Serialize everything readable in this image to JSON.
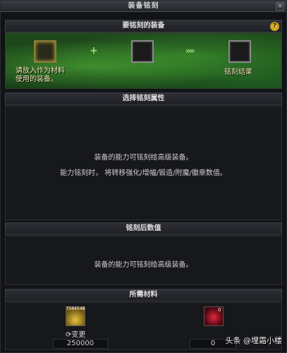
{
  "window": {
    "title": "装备铭刻",
    "close_label": "×"
  },
  "top_section": {
    "title": "要铭刻的装备",
    "help_label": "?"
  },
  "slots": {
    "material_caption": "请放入作为材料\n使用的装备。",
    "plus": "+",
    "arrows": "»»",
    "result_caption": "铭刻结果"
  },
  "attribute_section": {
    "title": "选择铭刻属性",
    "line1": "装备的能力可铭刻给高级装备。",
    "line2": "能力铭刻时， 将转移强化/增幅/锻造/附魔/徽章数值。"
  },
  "after_section": {
    "title": "铭刻后数值",
    "line1": "装备的能力可铭刻给高级装备。"
  },
  "materials_section": {
    "title": "所需材料",
    "gold_badge": "7584548",
    "change_label": "变更",
    "gold_amount": "250000",
    "gem_count": "0",
    "gem_amount": "0"
  },
  "watermark": "头条 @埋霜小楼",
  "colors": {
    "green_glow": "#5ac83c",
    "caption": "#f2e6b8",
    "gold": "#e8c240",
    "gem": "#e0283c"
  }
}
